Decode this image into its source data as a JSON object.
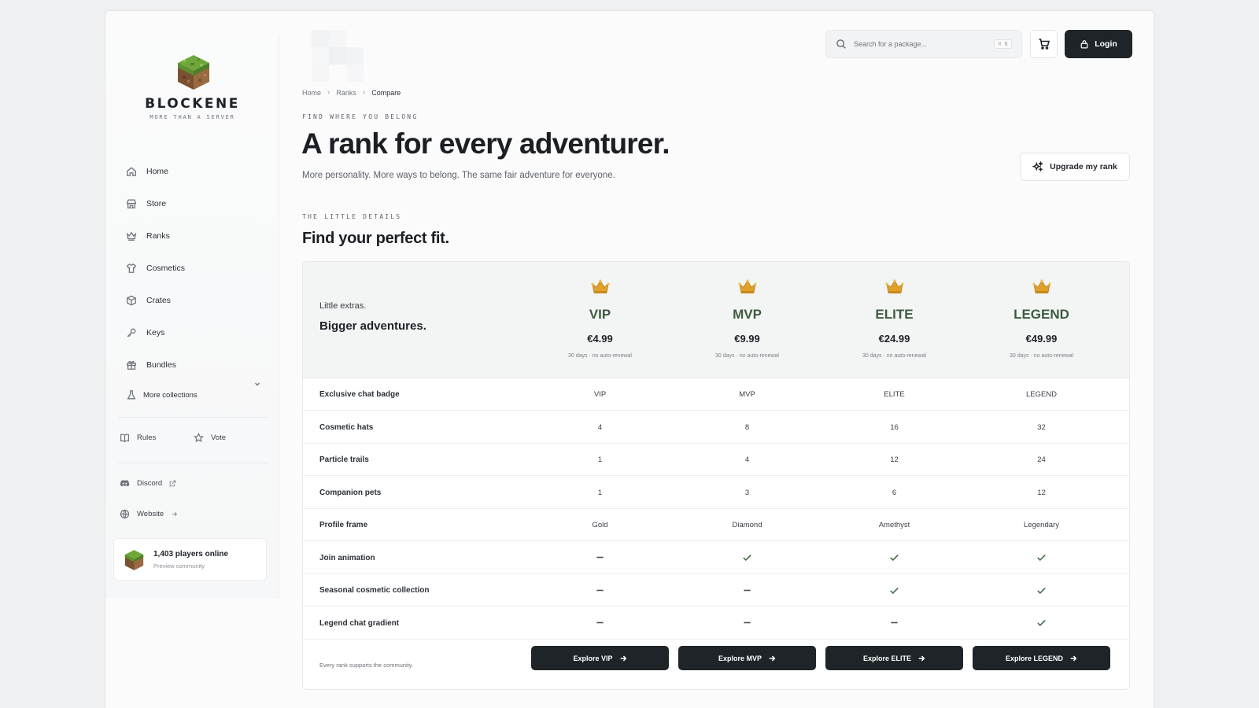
{
  "brand": {
    "name": "BLOCKENE",
    "tagline": "MORE THAN A SERVER"
  },
  "sidebar": {
    "items": [
      {
        "label": "Home",
        "icon": "home-icon"
      },
      {
        "label": "Store",
        "icon": "store-icon"
      },
      {
        "label": "Ranks",
        "icon": "crown-icon"
      },
      {
        "label": "Cosmetics",
        "icon": "shirt-icon"
      },
      {
        "label": "Crates",
        "icon": "box-icon"
      },
      {
        "label": "Keys",
        "icon": "key-icon"
      },
      {
        "label": "Bundles",
        "icon": "gift-icon"
      },
      {
        "label": "More collections",
        "icon": "flask-icon"
      }
    ],
    "rules_label": "Rules",
    "vote_label": "Vote",
    "discord_label": "Discord",
    "website_label": "Website",
    "online": {
      "title": "1,403 players online",
      "subtitle": "Preview community"
    }
  },
  "header": {
    "search_placeholder": "Search for a package...",
    "search_shortcut": "⌘ K",
    "login_label": "Login"
  },
  "breadcrumb": {
    "home": "Home",
    "ranks": "Ranks",
    "current": "Compare"
  },
  "hero": {
    "eyebrow": "FIND WHERE YOU BELONG",
    "title": "A rank for every adventurer.",
    "subtitle": "More personality. More ways to belong. The same fair adventure for everyone.",
    "upgrade_label": "Upgrade my rank"
  },
  "section": {
    "eyebrow": "THE LITTLE DETAILS",
    "title": "Find your perfect fit."
  },
  "table": {
    "tagline1": "Little extras.",
    "tagline2": "Bigger adventures.",
    "ranks": [
      {
        "name": "VIP",
        "price": "€4.99",
        "term": "30 days · no auto-renewal",
        "explore": "Explore VIP"
      },
      {
        "name": "MVP",
        "price": "€9.99",
        "term": "30 days · no auto-renewal",
        "explore": "Explore MVP"
      },
      {
        "name": "ELITE",
        "price": "€24.99",
        "term": "30 days · no auto-renewal",
        "explore": "Explore ELITE"
      },
      {
        "name": "LEGEND",
        "price": "€49.99",
        "term": "30 days · no auto-renewal",
        "explore": "Explore LEGEND"
      }
    ],
    "rows": [
      {
        "feature": "Exclusive chat badge",
        "values": [
          "VIP",
          "MVP",
          "ELITE",
          "LEGEND"
        ]
      },
      {
        "feature": "Cosmetic hats",
        "values": [
          "4",
          "8",
          "16",
          "32"
        ]
      },
      {
        "feature": "Particle trails",
        "values": [
          "1",
          "4",
          "12",
          "24"
        ]
      },
      {
        "feature": "Companion pets",
        "values": [
          "1",
          "3",
          "6",
          "12"
        ]
      },
      {
        "feature": "Profile frame",
        "values": [
          "Gold",
          "Diamond",
          "Amethyst",
          "Legendary"
        ]
      },
      {
        "feature": "Join animation",
        "values": [
          "—",
          "check",
          "check",
          "check"
        ]
      },
      {
        "feature": "Seasonal cosmetic collection",
        "values": [
          "—",
          "—",
          "check",
          "check"
        ]
      },
      {
        "feature": "Legend chat gradient",
        "values": [
          "—",
          "—",
          "—",
          "check"
        ]
      }
    ],
    "footer_note": "Every rank supports the community."
  },
  "colors": {
    "rank_name": "#3c5c3f",
    "check": "#3f6b45",
    "dark_button": "#1f2428",
    "crown": "#e0a12a"
  }
}
